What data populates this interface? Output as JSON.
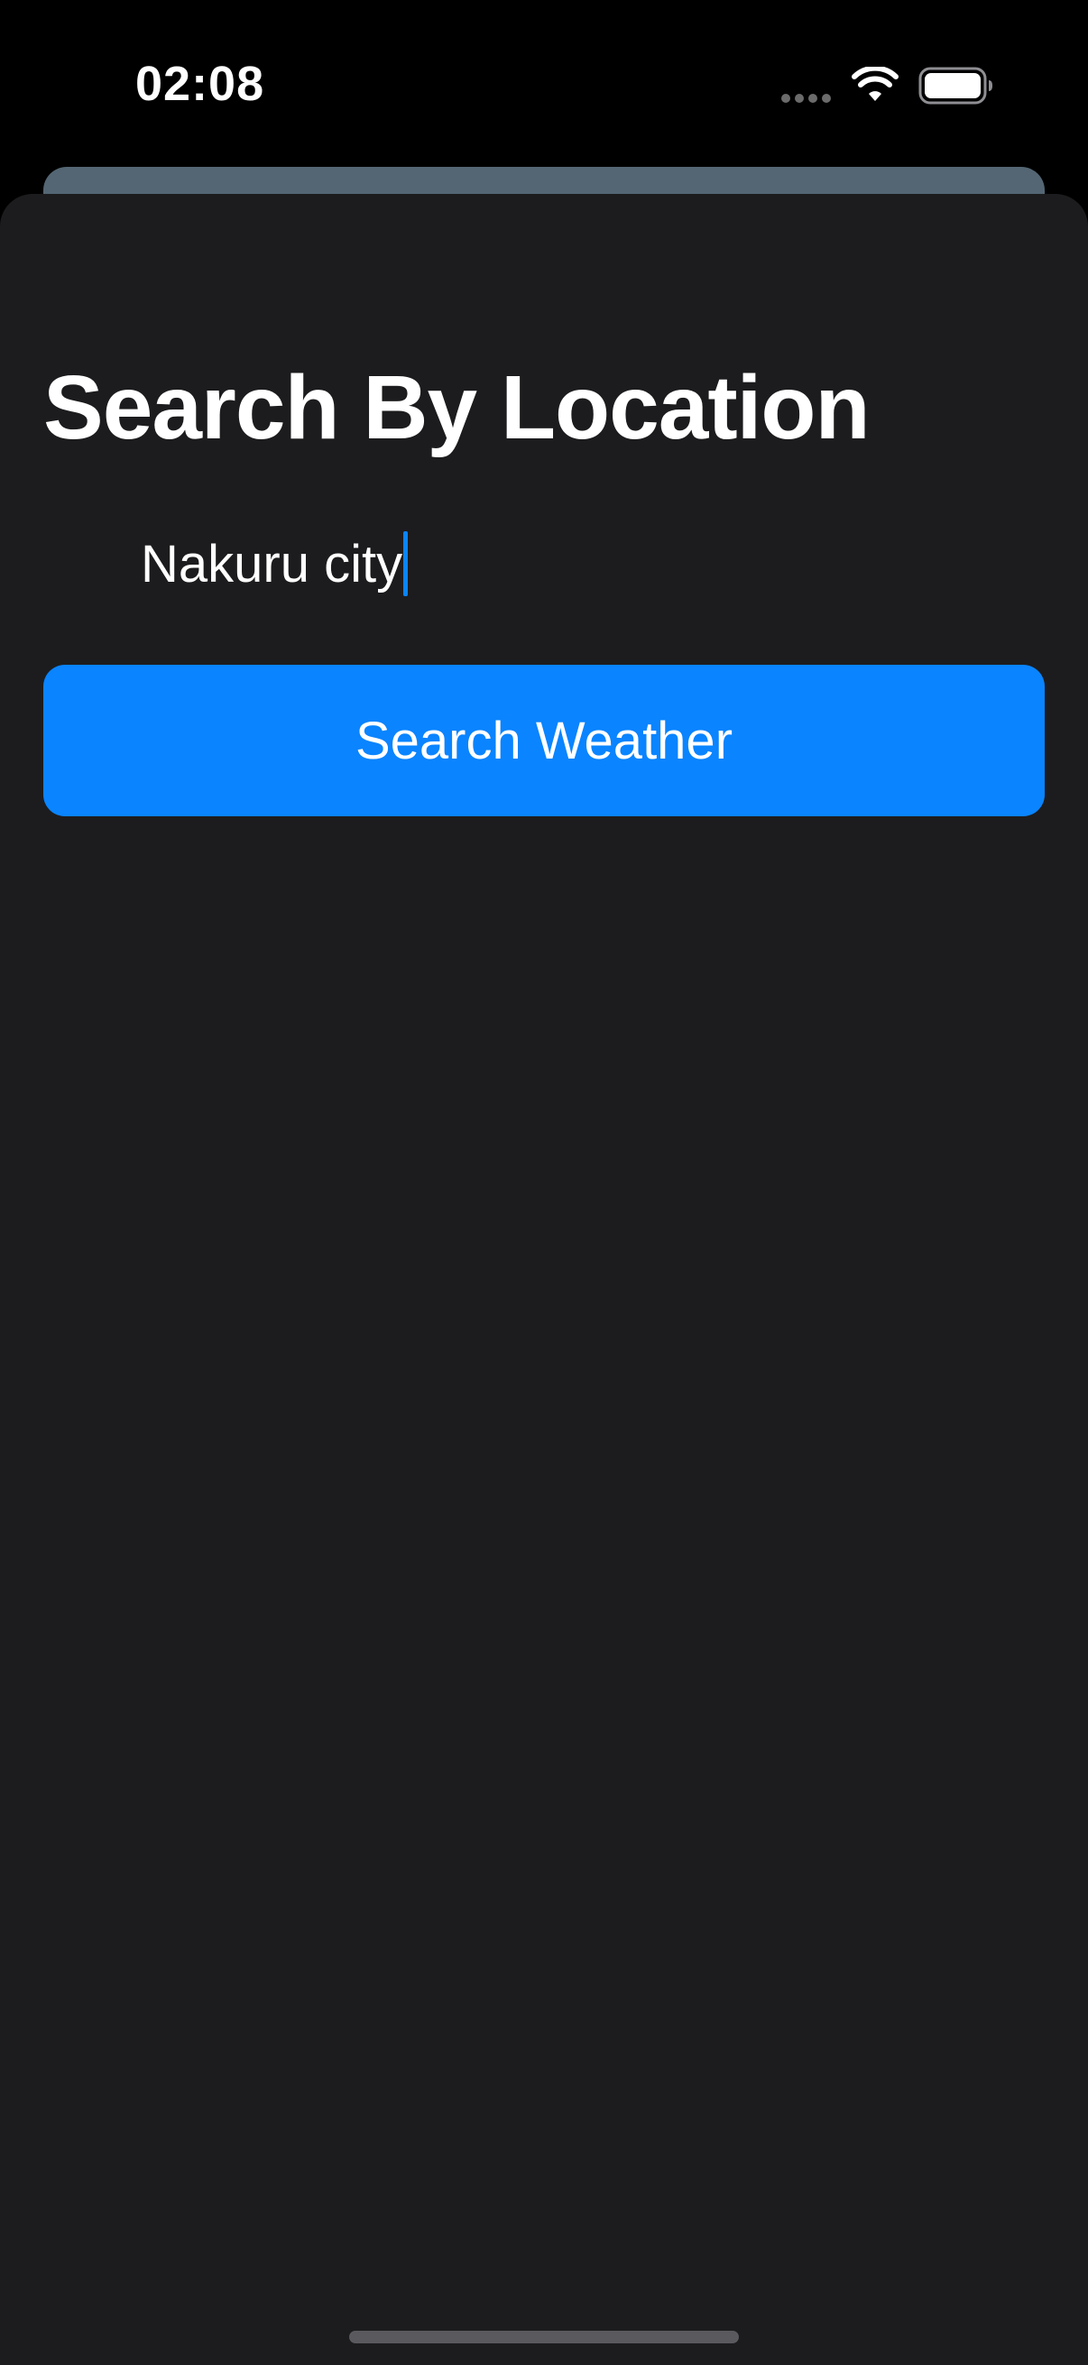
{
  "status_bar": {
    "time": "02:08",
    "icons": [
      "signal-dots-icon",
      "wifi-icon",
      "battery-icon"
    ]
  },
  "sheet": {
    "title": "Search By Location",
    "location_field": {
      "value": "Nakuru city"
    },
    "search_button": {
      "label": "Search Weather"
    }
  },
  "colors": {
    "accent": "#0a84ff",
    "sheet_background": "#1c1c1e",
    "peek_background": "#546673"
  }
}
